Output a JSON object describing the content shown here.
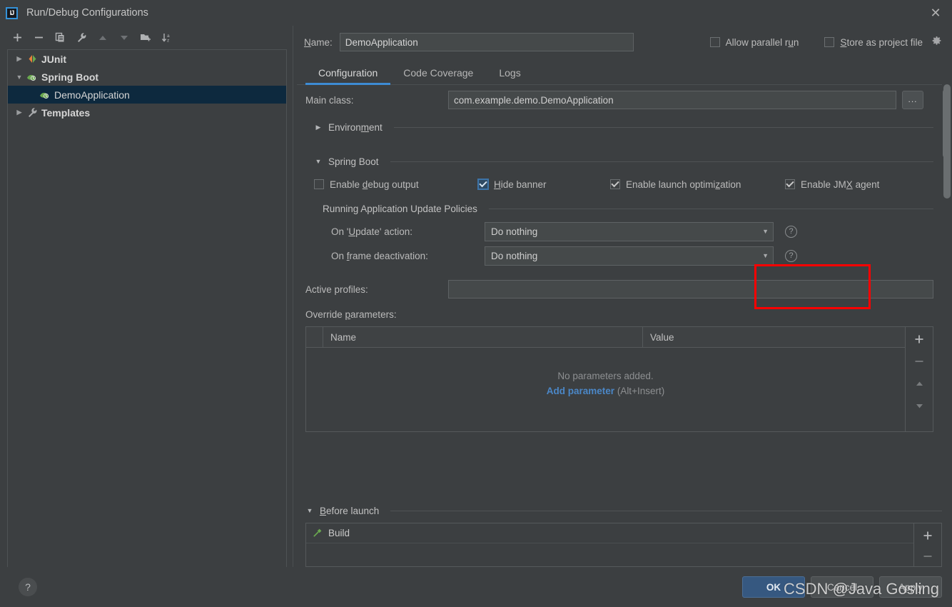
{
  "window": {
    "title": "Run/Debug Configurations",
    "logo_text": "IJ",
    "close_icon": "close-icon"
  },
  "left_panel": {
    "toolbar": [
      {
        "name": "add-configuration-button",
        "glyph": "+",
        "dim": false
      },
      {
        "name": "remove-configuration-button",
        "glyph": "−",
        "dim": false
      },
      {
        "name": "copy-configuration-button",
        "glyph": "❐",
        "dim": false
      },
      {
        "name": "edit-templates-button",
        "glyph": "🔧",
        "dim": false
      },
      {
        "name": "move-up-button",
        "glyph": "▲",
        "dim": true
      },
      {
        "name": "move-down-button",
        "glyph": "▼",
        "dim": true
      },
      {
        "name": "new-folder-button",
        "glyph": "📁",
        "dim": false
      },
      {
        "name": "sort-configurations-button",
        "glyph": "↓ᵃ₂",
        "dim": false
      }
    ],
    "tree": [
      {
        "label": "JUnit",
        "twisty": "▶",
        "icon": "junit-icon",
        "bold": true,
        "indent": 0,
        "selected": false
      },
      {
        "label": "Spring Boot",
        "twisty": "▼",
        "icon": "spring-boot-icon",
        "bold": true,
        "indent": 0,
        "selected": false
      },
      {
        "label": "DemoApplication",
        "twisty": "",
        "icon": "spring-boot-icon",
        "bold": false,
        "indent": 1,
        "selected": true
      },
      {
        "label": "Templates",
        "twisty": "▶",
        "icon": "templates-icon",
        "bold": true,
        "indent": 0,
        "selected": false
      }
    ]
  },
  "header": {
    "name_label": "Name:",
    "name_label_mnemonic": "N",
    "name_value": "DemoApplication",
    "allow_parallel_run": {
      "label": "Allow parallel run",
      "checked": false,
      "mnemonic": "u"
    },
    "store_as_project_file": {
      "label": "Store as project file",
      "checked": false,
      "mnemonic": "S"
    },
    "gear_icon": "gear-icon"
  },
  "tabs": [
    {
      "label": "Configuration",
      "active": true
    },
    {
      "label": "Code Coverage",
      "active": false
    },
    {
      "label": "Logs",
      "active": false
    }
  ],
  "configuration": {
    "main_class": {
      "label": "Main class:",
      "value": "com.example.demo.DemoApplication",
      "browse_label": "..."
    },
    "environment_section": {
      "title": "Environment",
      "expanded": false,
      "twisty": "▶",
      "mnemonic": "m"
    },
    "spring_boot_section": {
      "title": "Spring Boot",
      "expanded": true,
      "twisty": "▼",
      "checkboxes": [
        {
          "label": "Enable debug output",
          "checked": false,
          "focused": false,
          "mnemonic": "d",
          "name": "enable-debug-output-checkbox"
        },
        {
          "label": "Hide banner",
          "checked": true,
          "focused": true,
          "mnemonic": "H",
          "name": "hide-banner-checkbox"
        },
        {
          "label": "Enable launch optimization",
          "checked": true,
          "focused": false,
          "mnemonic": "z",
          "name": "enable-launch-optimization-checkbox"
        },
        {
          "label": "Enable JMX agent",
          "checked": true,
          "focused": false,
          "mnemonic": "X",
          "name": "enable-jmx-agent-checkbox"
        }
      ]
    },
    "update_policies": {
      "title": "Running Application Update Policies",
      "on_update_action": {
        "label": "On 'Update' action:",
        "value": "Do nothing",
        "mnemonic": "U"
      },
      "on_frame_deactivation": {
        "label": "On frame deactivation:",
        "value": "Do nothing",
        "mnemonic": "f"
      },
      "help_icon": "help-icon",
      "arrow_icon": "chevron-down-icon"
    },
    "active_profiles": {
      "label": "Active profiles:",
      "value": "",
      "mnemonic": "p"
    },
    "override_parameters": {
      "label": "Override parameters:",
      "mnemonic": "p",
      "columns": [
        "Name",
        "Value"
      ],
      "rows": [],
      "empty_message": "No parameters added.",
      "add_link": "Add parameter",
      "add_hint": "(Alt+Insert)",
      "side_buttons": [
        {
          "name": "add-parameter-button",
          "glyph": "+",
          "dim": false
        },
        {
          "name": "remove-parameter-button",
          "glyph": "−",
          "dim": true
        },
        {
          "name": "move-parameter-up-button",
          "glyph": "▲",
          "dim": true
        },
        {
          "name": "move-parameter-down-button",
          "glyph": "▼",
          "dim": true
        }
      ]
    }
  },
  "before_launch": {
    "title": "Before launch",
    "twisty": "▼",
    "mnemonic": "B",
    "tasks": [
      {
        "label": "Build",
        "icon": "build-hammer-icon"
      }
    ],
    "side_buttons": [
      {
        "name": "add-before-launch-task-button",
        "glyph": "+",
        "dim": false
      },
      {
        "name": "remove-before-launch-task-button",
        "glyph": "−",
        "dim": true
      }
    ]
  },
  "footer": {
    "help_label": "?",
    "buttons": [
      {
        "label": "OK",
        "style": "default",
        "name": "ok-button"
      },
      {
        "label": "Cancel",
        "style": "plain",
        "name": "cancel-button"
      },
      {
        "label": "Apply",
        "style": "plain",
        "name": "apply-button"
      }
    ]
  },
  "watermark": {
    "text": "CSDN @Java Gosling"
  },
  "colors": {
    "background": "#3c3f41",
    "accent_blue": "#3d8bd4",
    "link_blue": "#4b87c7",
    "selection": "#0d293e",
    "highlight_red": "#ff0000",
    "default_button": "#365880"
  }
}
